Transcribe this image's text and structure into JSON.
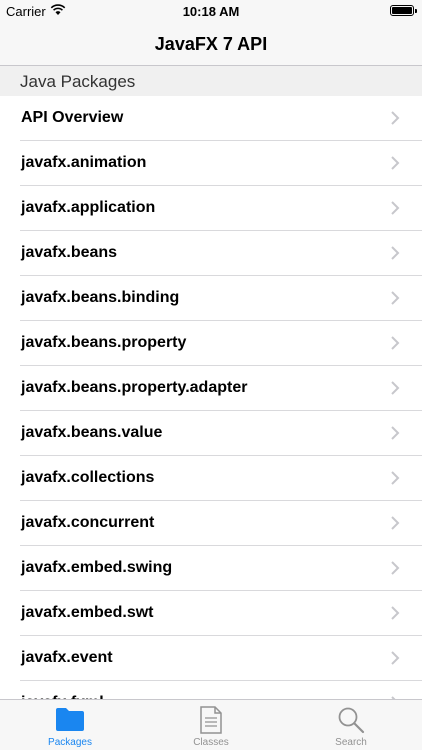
{
  "status_bar": {
    "carrier": "Carrier",
    "time": "10:18 AM"
  },
  "nav": {
    "title": "JavaFX 7 API"
  },
  "section": {
    "title": "Java Packages"
  },
  "packages": [
    "API Overview",
    "javafx.animation",
    "javafx.application",
    "javafx.beans",
    "javafx.beans.binding",
    "javafx.beans.property",
    "javafx.beans.property.adapter",
    "javafx.beans.value",
    "javafx.collections",
    "javafx.concurrent",
    "javafx.embed.swing",
    "javafx.embed.swt",
    "javafx.event",
    "javafx.fxml"
  ],
  "tabs": [
    {
      "label": "Packages",
      "icon": "folder-icon",
      "active": true
    },
    {
      "label": "Classes",
      "icon": "document-icon",
      "active": false
    },
    {
      "label": "Search",
      "icon": "search-icon",
      "active": false
    }
  ],
  "colors": {
    "accent": "#1a86f0",
    "inactive": "#929292",
    "bar": "#f7f7f7"
  }
}
